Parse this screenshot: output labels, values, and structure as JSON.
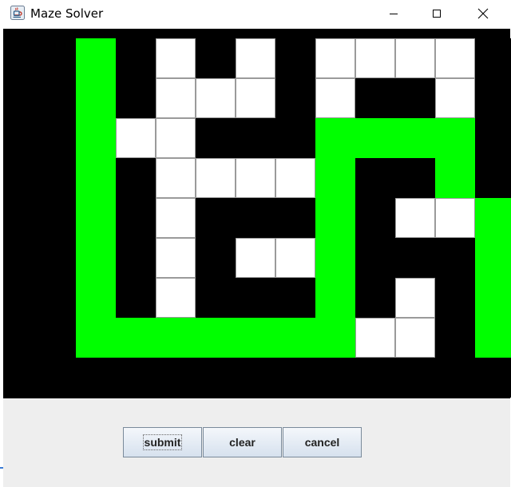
{
  "window": {
    "title": "Maze Solver",
    "app_icon": "java-icon",
    "controls": [
      "minimize-icon",
      "maximize-icon",
      "close-icon"
    ]
  },
  "maze": {
    "rows": 9,
    "cols": 12,
    "legend": {
      "W": "wall",
      "O": "open",
      "P": "path"
    },
    "grid": [
      "WPWOWOWOOOOW",
      "WPWOOOWOWWOW",
      "WPOOWWWPPPPW",
      "WPWOOOOPWWPW",
      "WPWOWWWPWOOP",
      "WPWOWOOPWWWP",
      "WPWOWWWPWOWP",
      "WPPPPPPPOOWP",
      "WWWWWWWWWWWW"
    ],
    "colors": {
      "wall": "#000000",
      "open": "#ffffff",
      "path": "#00ff00"
    }
  },
  "buttons": {
    "submit": "submit",
    "clear": "clear",
    "cancel": "cancel"
  }
}
